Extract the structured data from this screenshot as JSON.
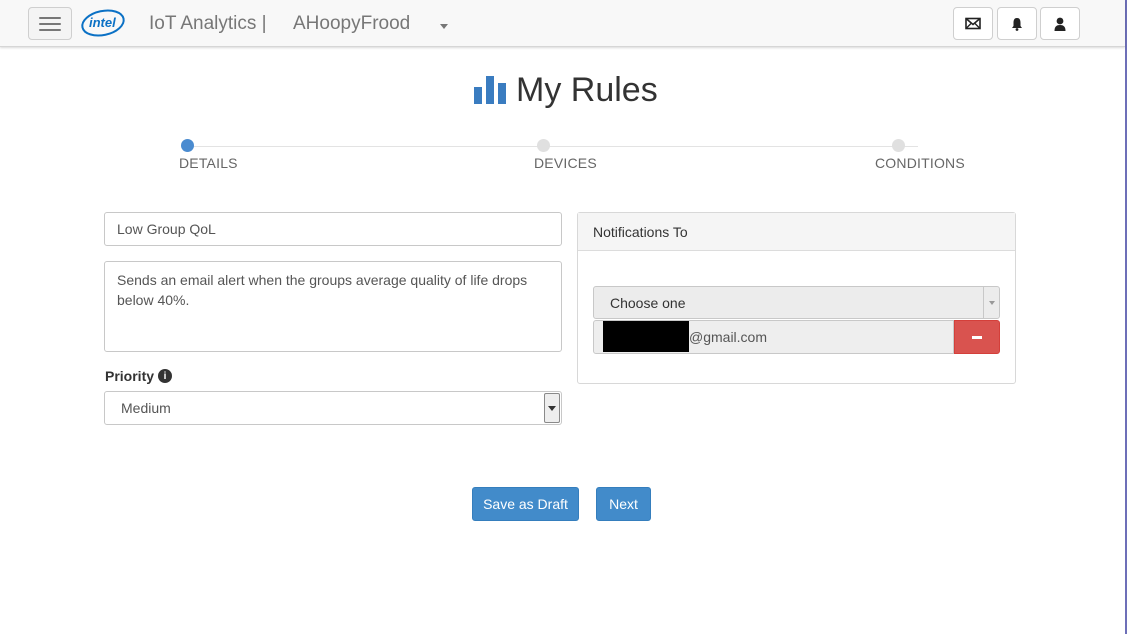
{
  "navbar": {
    "brand": "IoT Analytics |",
    "account": "AHoopyFrood",
    "logo_text": "intel"
  },
  "page": {
    "title": "My Rules"
  },
  "steps": [
    {
      "label": "DETAILS",
      "active": true
    },
    {
      "label": "DEVICES",
      "active": false
    },
    {
      "label": "CONDITIONS",
      "active": false
    }
  ],
  "form": {
    "name_value": "Low Group QoL",
    "description_value": "Sends an email alert when the groups average quality of life drops below 40%.",
    "priority_label": "Priority",
    "priority_value": "Medium"
  },
  "notifications": {
    "header": "Notifications To",
    "choose_placeholder": "Choose one",
    "email_suffix": "@gmail.com"
  },
  "actions": {
    "save_draft": "Save as Draft",
    "next": "Next"
  },
  "colors": {
    "primary": "#428bca",
    "danger": "#d9534f",
    "active_step": "#4a8bd0",
    "logo_blue": "#0b71c5"
  }
}
